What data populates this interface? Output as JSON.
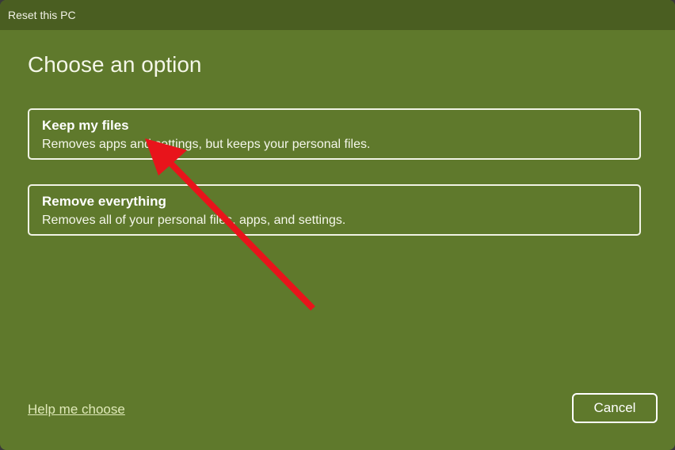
{
  "window": {
    "title": "Reset this PC"
  },
  "heading": "Choose an option",
  "options": [
    {
      "title": "Keep my files",
      "description": "Removes apps and settings, but keeps your personal files."
    },
    {
      "title": "Remove everything",
      "description": "Removes all of your personal files, apps, and settings."
    }
  ],
  "footer": {
    "help_link": "Help me choose",
    "cancel_label": "Cancel"
  },
  "colors": {
    "background": "#5f792c",
    "titlebar": "#4a5e21",
    "annotation_arrow": "#e8141b"
  }
}
